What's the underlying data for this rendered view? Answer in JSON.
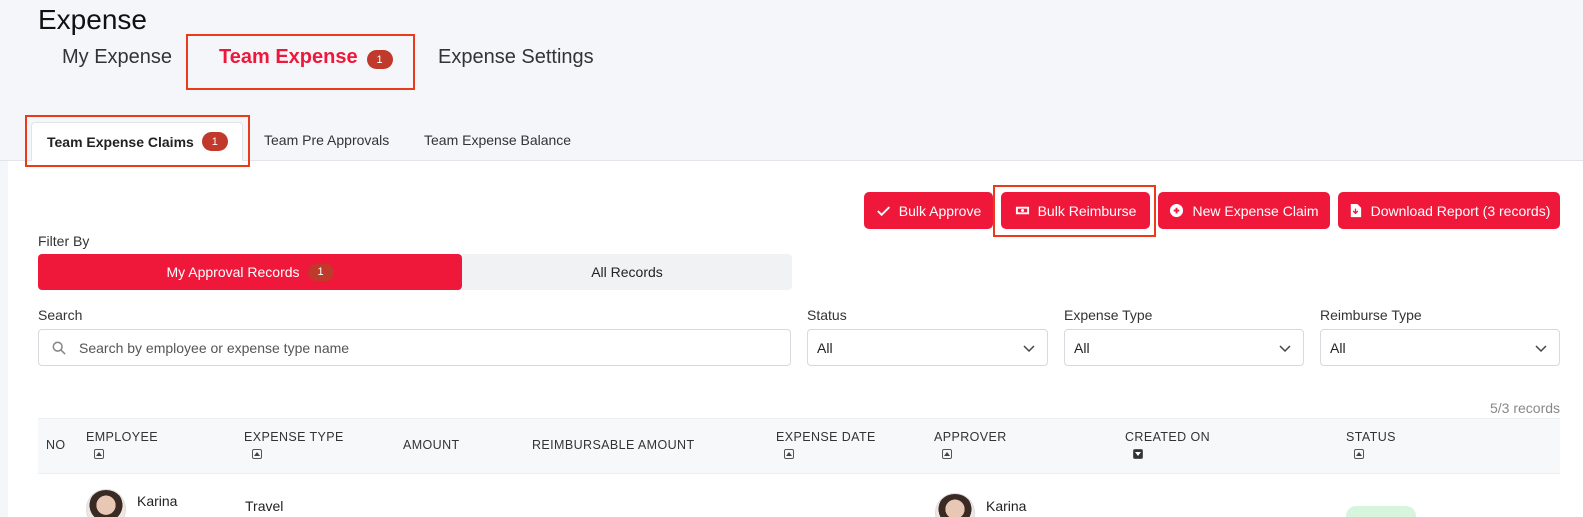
{
  "page": {
    "title": "Expense"
  },
  "top_tabs": [
    {
      "label": "My Expense"
    },
    {
      "label": "Team Expense",
      "badge": "1"
    },
    {
      "label": "Expense Settings"
    }
  ],
  "sub_tabs": [
    {
      "label": "Team Expense Claims",
      "badge": "1"
    },
    {
      "label": "Team Pre Approvals"
    },
    {
      "label": "Team Expense Balance"
    }
  ],
  "actions": {
    "bulk_approve": "Bulk Approve",
    "bulk_reimburse": "Bulk Reimburse",
    "new_claim": "New Expense Claim",
    "download_report": "Download Report (3 records)"
  },
  "filter": {
    "label": "Filter By",
    "my_approval": "My Approval Records",
    "my_approval_badge": "1",
    "all_records": "All Records"
  },
  "search": {
    "label": "Search",
    "placeholder": "Search by employee or expense type name"
  },
  "status_filter": {
    "label": "Status",
    "value": "All"
  },
  "expense_type_filter": {
    "label": "Expense Type",
    "value": "All"
  },
  "reimburse_type_filter": {
    "label": "Reimburse Type",
    "value": "All"
  },
  "records_count": "5/3 records",
  "table": {
    "headers": {
      "no": "NO",
      "employee": "EMPLOYEE",
      "expense_type": "EXPENSE TYPE",
      "amount": "AMOUNT",
      "reimbursable_amount": "REIMBURSABLE AMOUNT",
      "expense_date": "EXPENSE DATE",
      "approver": "APPROVER",
      "created_on": "CREATED ON",
      "status": "STATUS"
    },
    "rows": [
      {
        "employee": "Karina",
        "expense_type": "Travel",
        "approver": "Karina"
      }
    ]
  },
  "colors": {
    "accent": "#f0183a",
    "badge": "#c0392b",
    "highlight": "#ea3a1a"
  }
}
